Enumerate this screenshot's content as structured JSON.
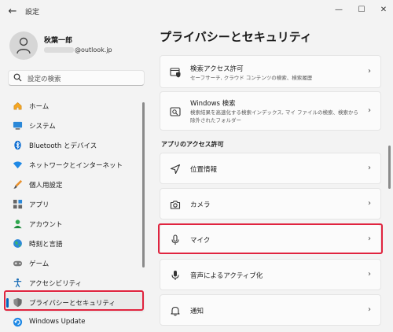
{
  "window": {
    "title": "設定",
    "back_glyph": "←",
    "min_glyph": "—",
    "max_glyph": "☐",
    "close_glyph": "✕"
  },
  "profile": {
    "name": "秋葉一郎",
    "email_suffix": "@outlook.jp"
  },
  "search": {
    "placeholder": "設定の検索",
    "icon": "search-icon"
  },
  "sidebar": {
    "items": [
      {
        "label": "ホーム",
        "icon": "home-icon"
      },
      {
        "label": "システム",
        "icon": "system-icon"
      },
      {
        "label": "Bluetooth とデバイス",
        "icon": "bluetooth-icon"
      },
      {
        "label": "ネットワークとインターネット",
        "icon": "wifi-icon"
      },
      {
        "label": "個人用設定",
        "icon": "brush-icon"
      },
      {
        "label": "アプリ",
        "icon": "apps-icon"
      },
      {
        "label": "アカウント",
        "icon": "account-icon"
      },
      {
        "label": "時刻と言語",
        "icon": "globe-icon"
      },
      {
        "label": "ゲーム",
        "icon": "gamepad-icon"
      },
      {
        "label": "アクセシビリティ",
        "icon": "accessibility-icon"
      },
      {
        "label": "プライバシーとセキュリティ",
        "icon": "shield-icon",
        "selected": true
      },
      {
        "label": "Windows Update",
        "icon": "update-icon"
      }
    ]
  },
  "main": {
    "title": "プライバシーとセキュリティ",
    "cards_top": [
      {
        "title": "検索アクセス許可",
        "desc": "セーフサーチ, クラウド コンテンツの検索、検索履歴",
        "icon": "search-permissions-icon"
      },
      {
        "title": "Windows 検索",
        "desc": "検索結果を高速化する検索インデックス, マイ ファイルの検索、検索から除外されたフォルダー",
        "icon": "windows-search-icon"
      }
    ],
    "section_label": "アプリのアクセス許可",
    "cards_app": [
      {
        "title": "位置情報",
        "icon": "location-icon"
      },
      {
        "title": "カメラ",
        "icon": "camera-icon"
      },
      {
        "title": "マイク",
        "icon": "microphone-icon",
        "highlighted": true
      },
      {
        "title": "音声によるアクティブ化",
        "icon": "voice-activation-icon"
      },
      {
        "title": "通知",
        "icon": "bell-icon"
      }
    ],
    "chevron": "›"
  },
  "colors": {
    "accent": "#0067c0",
    "highlight_box": "#e0243f",
    "background": "#f3f3f3",
    "card": "#fbfbfb"
  }
}
